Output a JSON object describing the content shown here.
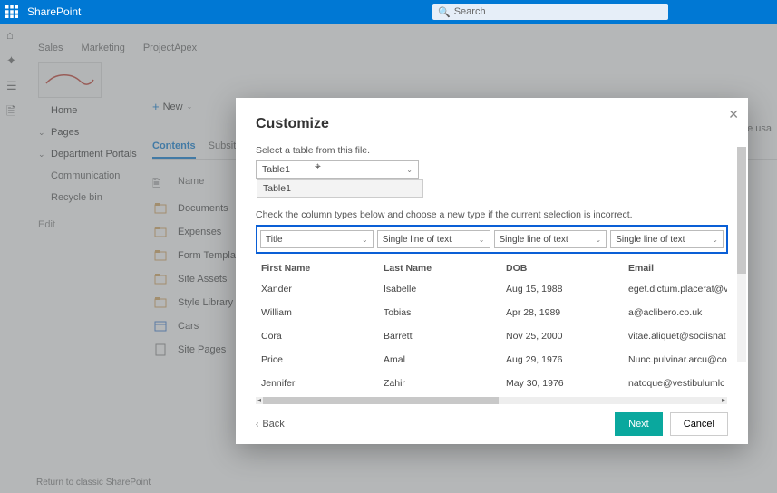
{
  "suite": {
    "appName": "SharePoint",
    "searchPlaceholder": "Search"
  },
  "siteTabs": [
    "Sales",
    "Marketing",
    "ProjectApex"
  ],
  "leftRailIcons": [
    "home-icon",
    "globe-icon",
    "list-icon",
    "file-icon"
  ],
  "nav": {
    "home": "Home",
    "pages": "Pages",
    "deptPortals": "Department Portals",
    "communication": "Communication",
    "recycle": "Recycle bin",
    "edit": "Edit",
    "classicLink": "Return to classic SharePoint"
  },
  "toolbar": {
    "new": "New"
  },
  "siteUsage": "Site usa",
  "pageTabs": {
    "contents": "Contents",
    "subsites": "Subsites"
  },
  "listHeader": {
    "name": "Name"
  },
  "docList": [
    {
      "icon": "library-icon",
      "name": "Documents"
    },
    {
      "icon": "library-icon",
      "name": "Expenses"
    },
    {
      "icon": "library-icon",
      "name": "Form Templates"
    },
    {
      "icon": "library-icon",
      "name": "Site Assets"
    },
    {
      "icon": "library-icon",
      "name": "Style Library"
    },
    {
      "icon": "list-icon",
      "name": "Cars"
    },
    {
      "icon": "page-icon",
      "name": "Site Pages"
    }
  ],
  "modal": {
    "title": "Customize",
    "selectTableLabel": "Select a table from this file.",
    "selectedTable": "Table1",
    "dropdownOption": "Table1",
    "columnHint": "Check the column types below and choose a new type if the current selection is incorrect.",
    "columnTypes": [
      "Title",
      "Single line of text",
      "Single line of text",
      "Single line of text"
    ],
    "columns": [
      "First Name",
      "Last Name",
      "DOB",
      "Email"
    ],
    "rows": [
      {
        "first": "Xander",
        "last": "Isabelle",
        "dob": "Aug 15, 1988",
        "email": "eget.dictum.placerat@v"
      },
      {
        "first": "William",
        "last": "Tobias",
        "dob": "Apr 28, 1989",
        "email": "a@aclibero.co.uk"
      },
      {
        "first": "Cora",
        "last": "Barrett",
        "dob": "Nov 25, 2000",
        "email": "vitae.aliquet@sociisnat"
      },
      {
        "first": "Price",
        "last": "Amal",
        "dob": "Aug 29, 1976",
        "email": "Nunc.pulvinar.arcu@co"
      },
      {
        "first": "Jennifer",
        "last": "Zahir",
        "dob": "May 30, 1976",
        "email": "natoque@vestibulumlc"
      }
    ],
    "back": "Back",
    "next": "Next",
    "cancel": "Cancel"
  }
}
